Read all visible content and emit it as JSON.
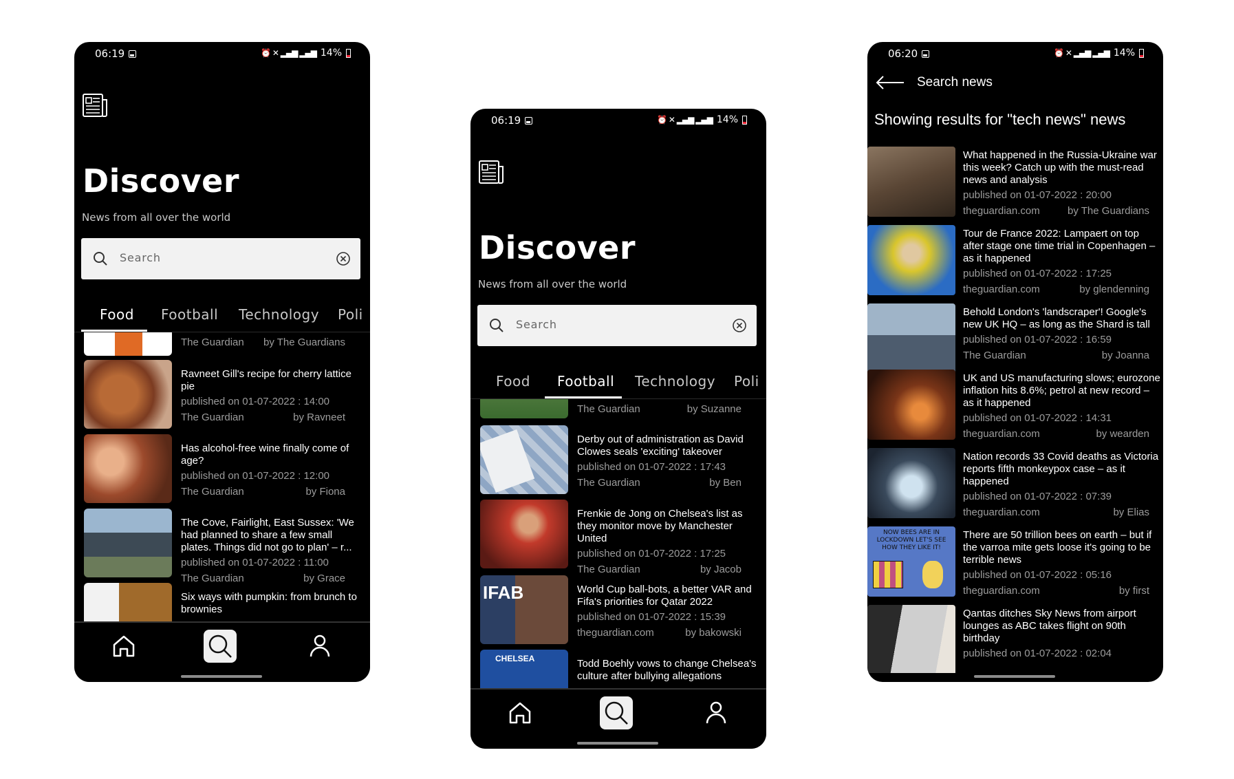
{
  "status1": {
    "time": "06:19",
    "battery": "14%"
  },
  "status2": {
    "time": "06:19",
    "battery": "14%"
  },
  "status3": {
    "time": "06:20",
    "battery": "14%"
  },
  "discover": {
    "title": "Discover",
    "subtitle": "News from all over the world",
    "search_placeholder": "Search"
  },
  "tabs": [
    "Food",
    "Football",
    "Technology",
    "Poli"
  ],
  "food_articles": [
    {
      "title": "",
      "date": "",
      "source": "The Guardian",
      "author": "by The Guardians"
    },
    {
      "title": "Ravneet Gill's recipe for cherry lattice pie",
      "date": "published on 01-07-2022 : 14:00",
      "source": "The Guardian",
      "author": "by Ravneet"
    },
    {
      "title": "Has alcohol-free wine finally come of age?",
      "date": "published on 01-07-2022 : 12:00",
      "source": "The Guardian",
      "author": "by Fiona"
    },
    {
      "title": "The Cove, Fairlight, East Sussex: 'We had planned to share a few small plates. Things did not go to plan' – r...",
      "date": "published on 01-07-2022 : 11:00",
      "source": "The Guardian",
      "author": "by Grace"
    },
    {
      "title": "Six ways with pumpkin: from brunch to brownies",
      "date": "",
      "source": "",
      "author": ""
    }
  ],
  "football_articles": [
    {
      "title": "",
      "date": "",
      "source": "The Guardian",
      "author": "by Suzanne"
    },
    {
      "title": "Derby out of administration as David Clowes seals 'exciting' takeover",
      "date": "published on 01-07-2022 : 17:43",
      "source": "The Guardian",
      "author": "by Ben"
    },
    {
      "title": "Frenkie de Jong on Chelsea's list as they monitor move by Manchester United",
      "date": "published on 01-07-2022 : 17:25",
      "source": "The Guardian",
      "author": "by Jacob"
    },
    {
      "title": "World Cup ball-bots, a better VAR and Fifa's priorities for Qatar 2022",
      "date": "published on 01-07-2022 : 15:39",
      "source": "theguardian.com",
      "author": "by bakowski"
    },
    {
      "title": "Todd Boehly vows to change Chelsea's culture after bullying allegations",
      "date": "",
      "source": "",
      "author": ""
    }
  ],
  "search_results": {
    "back_label": "Search news",
    "heading": "Showing results for \"tech news\" news",
    "articles": [
      {
        "title": "What happened in the Russia-Ukraine war this week? Catch up with the must-read news and analysis",
        "date": "published on 01-07-2022 : 20:00",
        "source": "theguardian.com",
        "author": "by The Guardians"
      },
      {
        "title": "Tour de France 2022: Lampaert on top after stage one time trial in Copenhagen – as it happened",
        "date": "published on 01-07-2022 : 17:25",
        "source": "theguardian.com",
        "author": "by glendenning"
      },
      {
        "title": "Behold London's 'landscraper'! Google's new UK HQ – as long as the Shard is tall",
        "date": "published on 01-07-2022 : 16:59",
        "source": "The Guardian",
        "author": "by Joanna"
      },
      {
        "title": "UK and US manufacturing slows; eurozone inflation hits 8.6%; petrol at new record – as it happened",
        "date": "published on 01-07-2022 : 14:31",
        "source": "theguardian.com",
        "author": "by wearden"
      },
      {
        "title": "Nation records 33 Covid deaths as Victoria reports fifth monkeypox case – as it happened",
        "date": "published on 01-07-2022 : 07:39",
        "source": "theguardian.com",
        "author": "by Elias"
      },
      {
        "title": "There are 50 trillion bees on earth – but if the varroa mite gets loose it's going to be terrible news",
        "date": "published on 01-07-2022 : 05:16",
        "source": "theguardian.com",
        "author": "by first"
      },
      {
        "title": "Qantas ditches Sky News from airport lounges as ABC takes flight on 90th birthday",
        "date": "published on 01-07-2022 : 02:04",
        "source": "",
        "author": ""
      }
    ],
    "bee_image_text": "NOW BEES ARE IN LOCKDOWN LET'S SEE HOW THEY LIKE IT!"
  },
  "thumb_art": {
    "food": [
      "#c8571f",
      "#7b3b21",
      "#9c4a2c",
      "#3d4a55",
      "#a06a2b"
    ],
    "football": [
      "#3b6b2f",
      "#b9c7d8",
      "#c23a2b",
      "#2c3f63",
      "#1f4fa0"
    ],
    "search": [
      "#5a4635",
      "#d9c62c",
      "#4d5c6e",
      "#7a3518",
      "#3a4a5c",
      "#5678c6",
      "#cfcfcf"
    ]
  },
  "football_thumb_text": {
    "ifab": "IFAB",
    "chelsea": "CHELSEA"
  }
}
